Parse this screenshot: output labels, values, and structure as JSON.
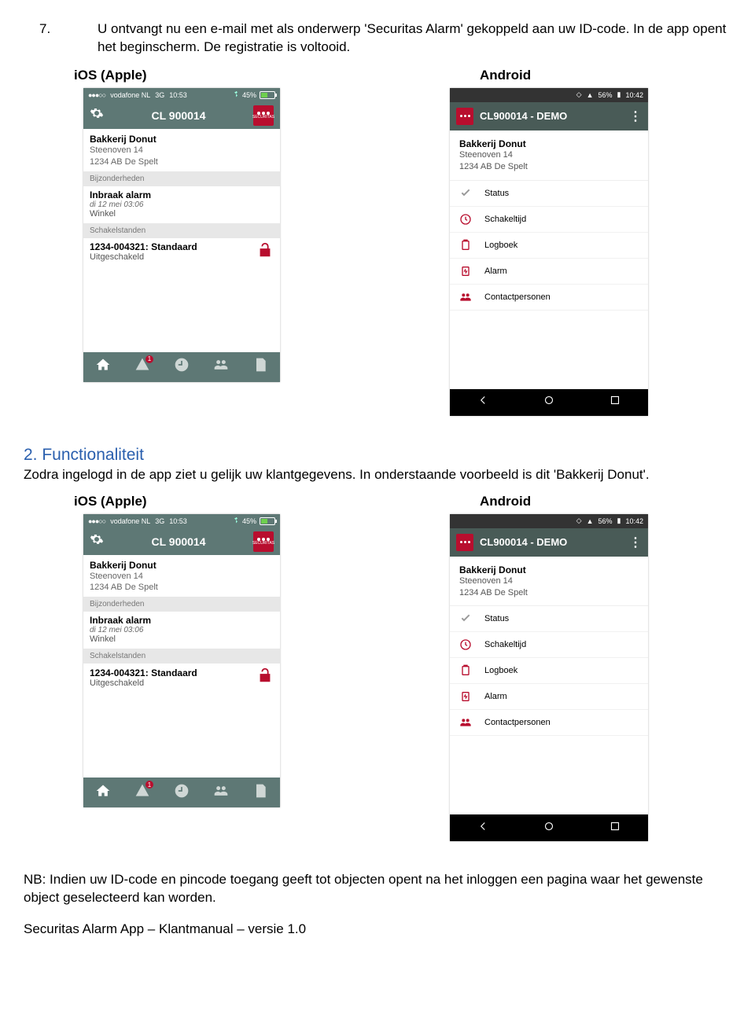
{
  "step7": {
    "num": "7.",
    "text": "U ontvangt nu een e-mail met als onderwerp 'Securitas Alarm' gekoppeld aan uw ID-code. In de app opent het beginscherm. De registratie is voltooid."
  },
  "labels": {
    "ios": "iOS (Apple)",
    "android": "Android"
  },
  "ios_status": {
    "dots": "●●●○○",
    "carrier": "vodafone NL",
    "net": "3G",
    "time": "10:53",
    "batt_pct": "45%"
  },
  "ios_header_title": "CL 900014",
  "sec_label": "SECURITAS",
  "ios_info": {
    "name": "Bakkerij Donut",
    "addr1": "Steenoven 14",
    "addr2": "1234 AB  De Spelt"
  },
  "ios_sections": {
    "bijz": "Bijzonderheden",
    "schakel": "Schakelstanden"
  },
  "ios_alarm": {
    "line1": "Inbraak alarm",
    "line2": "di 12 mei 03:06",
    "line3": "Winkel"
  },
  "ios_schakel": {
    "line1": "1234-004321: Standaard",
    "line2": "Uitgeschakeld"
  },
  "ios_badge": "1",
  "and_status": {
    "pct": "56%",
    "time": "10:42"
  },
  "and_header_title": "CL900014 - DEMO",
  "and_menu": "⋮",
  "and_info": {
    "name": "Bakkerij Donut",
    "addr1": "Steenoven 14",
    "addr2": "1234 AB De Spelt"
  },
  "and_items": {
    "status": "Status",
    "schakel": "Schakeltijd",
    "logboek": "Logboek",
    "alarm": "Alarm",
    "contact": "Contactpersonen"
  },
  "section2": {
    "heading": "2. Functionaliteit",
    "para": "Zodra ingelogd in de app ziet u gelijk uw klantgegevens. In onderstaande voorbeeld is dit 'Bakkerij Donut'."
  },
  "nb": "NB: Indien uw ID-code en pincode toegang geeft tot objecten opent na het inloggen een pagina waar het gewenste object geselecteerd kan worden.",
  "footer": "Securitas Alarm App – Klantmanual – versie 1.0"
}
